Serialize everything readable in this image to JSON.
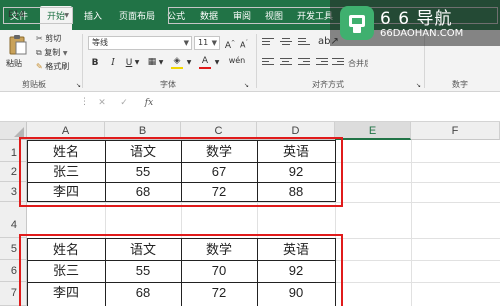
{
  "ribbon_tabs": [
    {
      "label": "文件"
    },
    {
      "label": "开始",
      "active": true
    },
    {
      "label": "插入"
    },
    {
      "label": "页面布局"
    },
    {
      "label": "公式"
    },
    {
      "label": "数据"
    },
    {
      "label": "审阅"
    },
    {
      "label": "视图"
    },
    {
      "label": "开发工具"
    }
  ],
  "clipboard": {
    "paste_label": "粘贴",
    "cut_label": "剪切",
    "copy_label": "复制",
    "format_painter_label": "格式刷",
    "group_label": "剪贴板"
  },
  "font": {
    "name": "等线",
    "size": "11",
    "bold": "B",
    "italic": "I",
    "underline": "U",
    "group_label": "字体"
  },
  "alignment": {
    "group_label": "对齐方式",
    "merge_label": "合并后居中"
  },
  "number": {
    "group_label": "数字"
  },
  "formula_bar": {
    "name_box": "E14",
    "fx": "fx",
    "cancel": "✕",
    "enter": "✓",
    "formula": ""
  },
  "columns": [
    "A",
    "B",
    "C",
    "D",
    "E",
    "F"
  ],
  "rows": [
    "1",
    "2",
    "3",
    "4",
    "5",
    "6",
    "7"
  ],
  "table1": {
    "header": [
      "姓名",
      "语文",
      "数学",
      "英语"
    ],
    "rows": [
      [
        "张三",
        "55",
        "67",
        "92"
      ],
      [
        "李四",
        "68",
        "72",
        "88"
      ]
    ]
  },
  "table2": {
    "header": [
      "姓名",
      "语文",
      "数学",
      "英语"
    ],
    "rows": [
      [
        "张三",
        "55",
        "70",
        "92"
      ],
      [
        "李四",
        "68",
        "72",
        "90"
      ]
    ]
  },
  "watermark": {
    "title": "6 6 导航",
    "subtitle": "66DAOHAN.COM"
  },
  "colors": {
    "excel_green": "#217346",
    "highlight_red": "#e01b1b"
  }
}
